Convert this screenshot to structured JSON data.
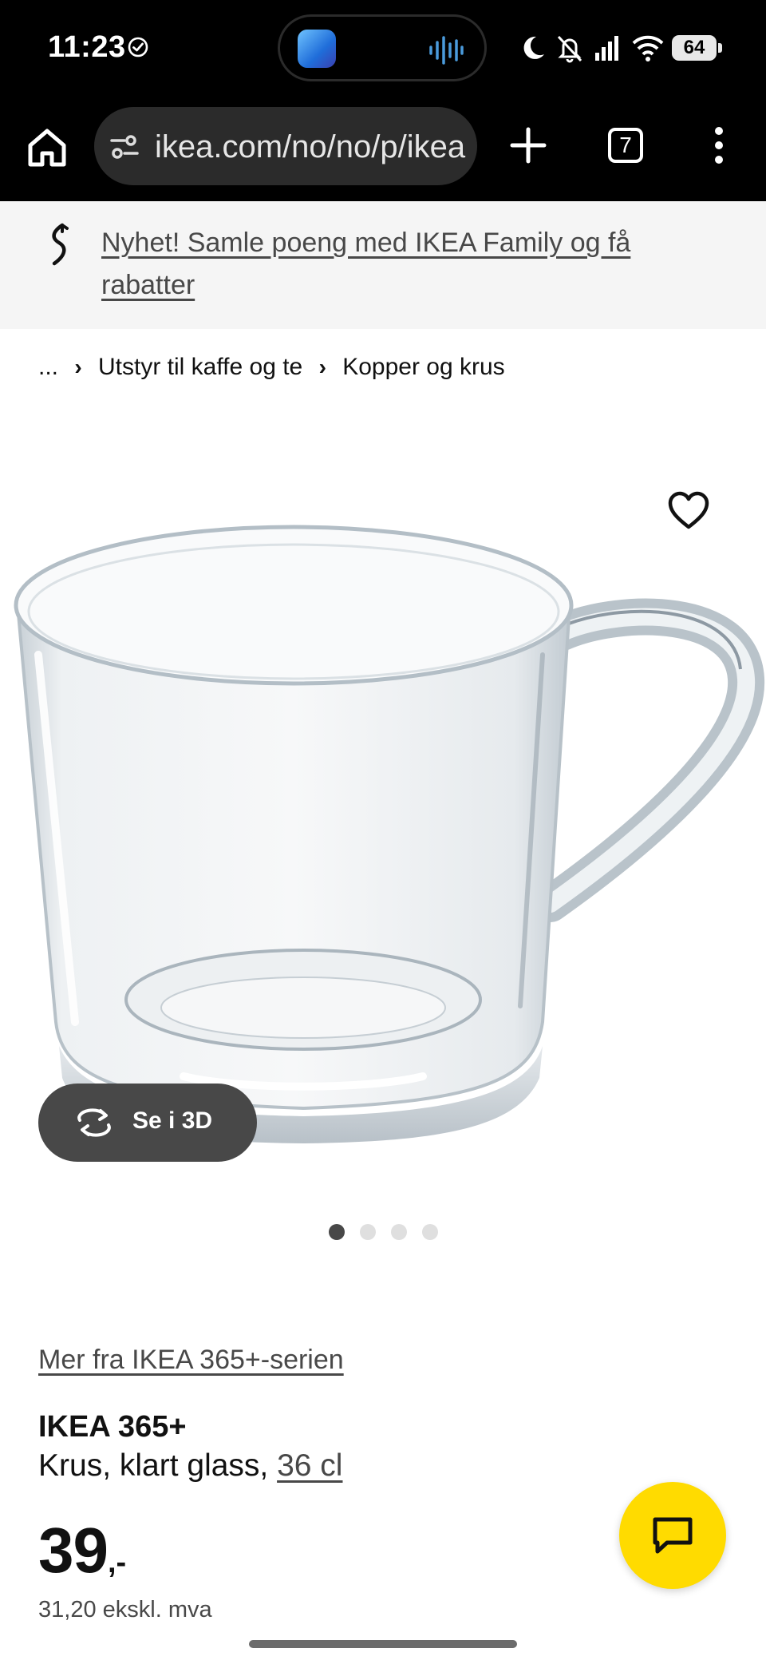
{
  "status_bar": {
    "time": "11:23",
    "battery": "64"
  },
  "browser": {
    "url": "ikea.com/no/no/p/ikea",
    "tab_count": "7"
  },
  "banner": {
    "text": "Nyhet! Samle poeng med IKEA Family og få rabatter"
  },
  "breadcrumb": {
    "ellipsis": "...",
    "items": [
      "Utstyr til kaffe og te",
      "Kopper og krus"
    ]
  },
  "product": {
    "image_alt": "glass mug",
    "view_3d_label": "Se i 3D",
    "carousel": {
      "count": 4,
      "active": 1
    },
    "series_link": "Mer fra IKEA 365+-serien",
    "name": "IKEA 365+",
    "description": "Krus, klart glass, ",
    "size": "36 cl",
    "price_main": "39",
    "price_decimal": ",-",
    "price_ex_vat": "31,20 ekskl. mva"
  },
  "icons": {
    "status_check": "check-circle-icon",
    "home": "home-icon",
    "site_settings": "tune-icon",
    "new_tab": "plus-icon",
    "menu": "more-vert-icon",
    "banner": "ikea-family-icon",
    "favourite": "heart-icon",
    "rotate": "rotate-3d-icon",
    "chat": "chat-icon"
  },
  "colors": {
    "chat_button": "#ffdb00",
    "button_dark": "#484848",
    "banner_bg": "#f5f5f5"
  }
}
